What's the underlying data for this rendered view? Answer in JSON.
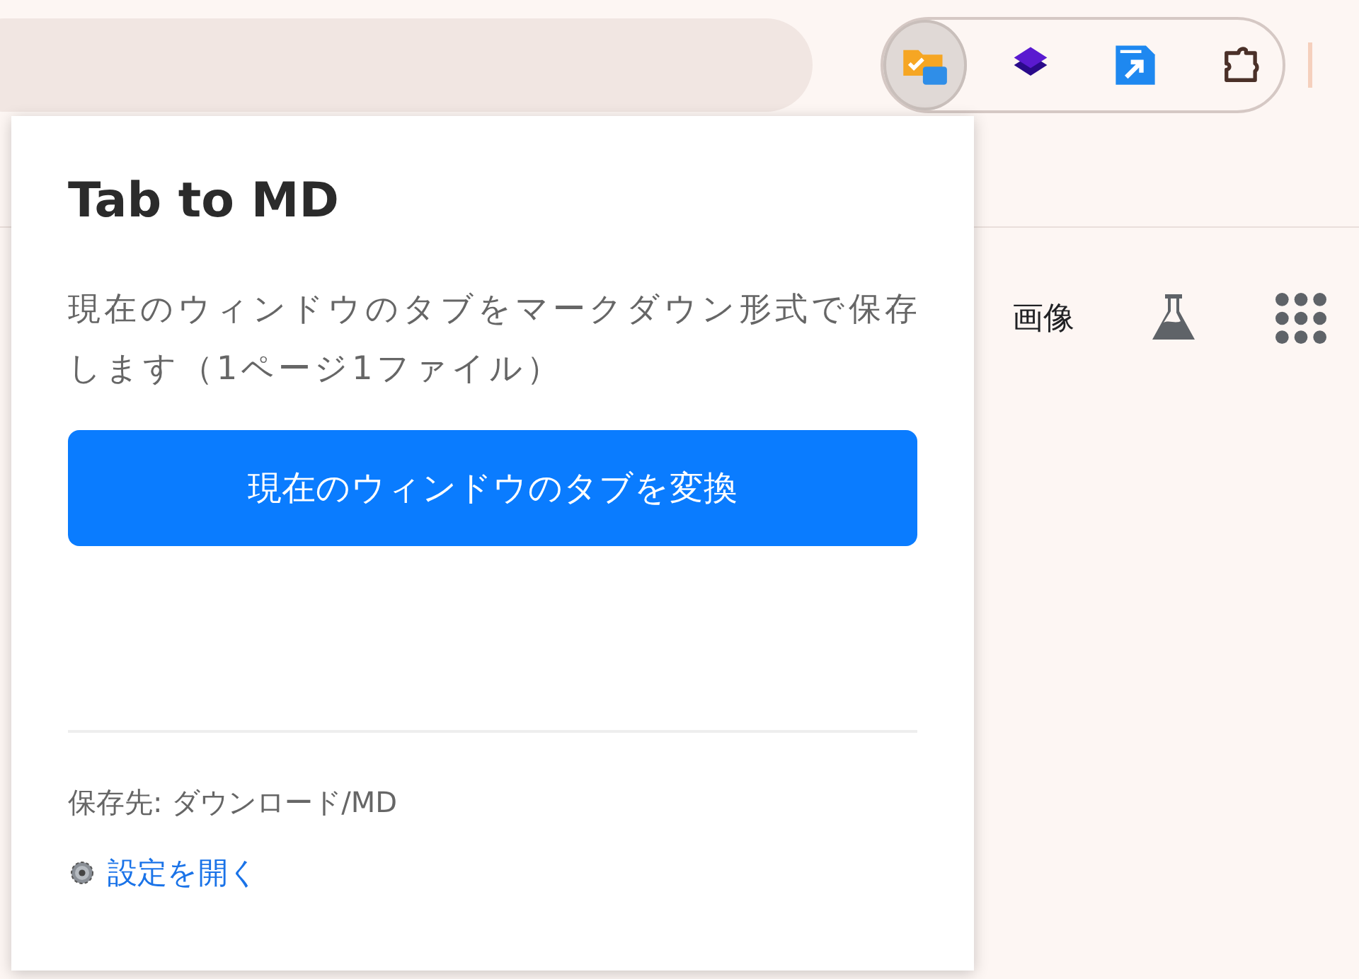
{
  "toolbar": {
    "extensions": [
      {
        "kind": "md",
        "selected": true
      },
      {
        "kind": "layers",
        "selected": false
      },
      {
        "kind": "open",
        "selected": false
      },
      {
        "kind": "puzzle",
        "selected": false
      }
    ]
  },
  "page": {
    "nav": [
      {
        "kind": "text",
        "label": "画像"
      },
      {
        "kind": "flask"
      },
      {
        "kind": "apps"
      }
    ]
  },
  "popup": {
    "title": "Tab to MD",
    "description": "現在のウィンドウのタブをマークダウン形式で保存します（1ページ1ファイル）",
    "button": "現在のウィンドウのタブを変換",
    "save_path": "保存先: ダウンロード/MD",
    "settings_link": "設定を開く"
  }
}
